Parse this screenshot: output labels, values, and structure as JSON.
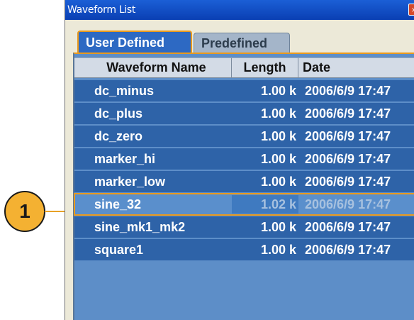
{
  "callout": {
    "label": "1"
  },
  "window": {
    "title": "Waveform List",
    "close_glyph": "×"
  },
  "tabs": [
    {
      "label": "User Defined",
      "active": true
    },
    {
      "label": "Predefined",
      "active": false
    }
  ],
  "table": {
    "columns": [
      "Waveform Name",
      "Length",
      "Date"
    ],
    "rows": [
      {
        "name": "dc_minus",
        "length": "1.00 k",
        "date": "2006/6/9 17:47"
      },
      {
        "name": "dc_plus",
        "length": "1.00 k",
        "date": "2006/6/9 17:47"
      },
      {
        "name": "dc_zero",
        "length": "1.00 k",
        "date": "2006/6/9 17:47"
      },
      {
        "name": "marker_hi",
        "length": "1.00 k",
        "date": "2006/6/9 17:47"
      },
      {
        "name": "marker_low",
        "length": "1.00 k",
        "date": "2006/6/9 17:47"
      },
      {
        "name": "sine_32",
        "length": "1.02 k",
        "date": "2006/6/9 17:47",
        "selected": true
      },
      {
        "name": "sine_mk1_mk2",
        "length": "1.00 k",
        "date": "2006/6/9 17:47"
      },
      {
        "name": "square1",
        "length": "1.00 k",
        "date": "2006/6/9 17:47"
      }
    ]
  },
  "colors": {
    "titlebar": "#0a3fb3",
    "panel_bg": "#5d8ec8",
    "row_bg": "#2e63a8",
    "accent_orange": "#e99a1e",
    "callout_fill": "#f4b132"
  }
}
